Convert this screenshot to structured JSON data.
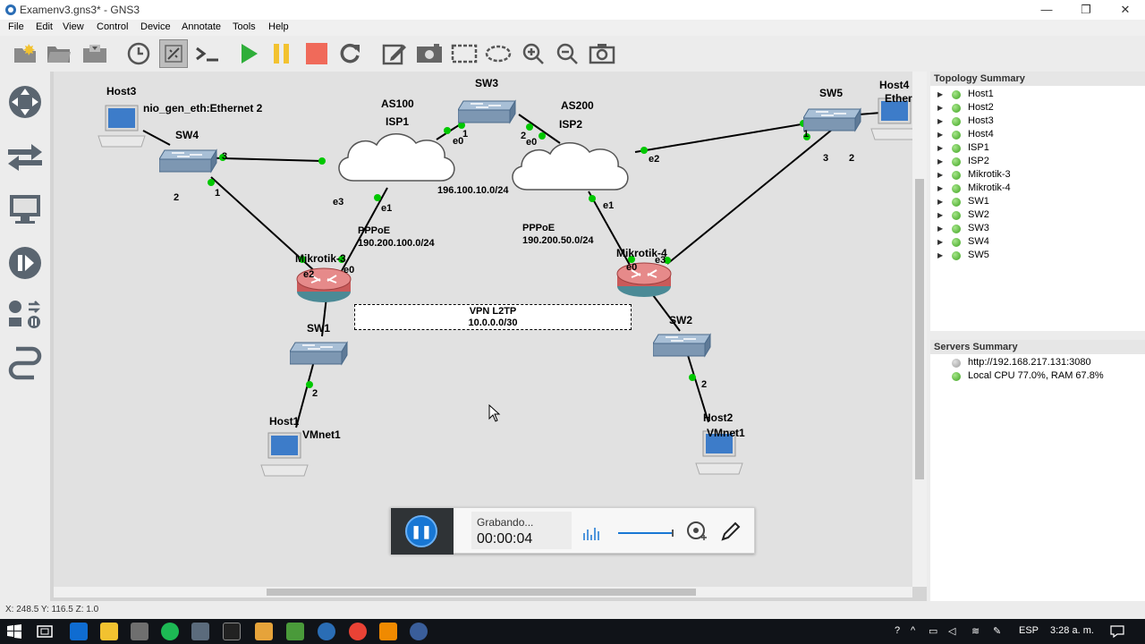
{
  "window": {
    "title": "Examenv3.gns3* - GNS3",
    "minimize": "—",
    "restore": "❐",
    "close": "✕"
  },
  "menu": [
    "File",
    "Edit",
    "View",
    "Control",
    "Device",
    "Annotate",
    "Tools",
    "Help"
  ],
  "toolbar": {
    "icons": [
      "new-project-icon",
      "open-folder-icon",
      "save-icon",
      "snapshot-clock-icon",
      "show-interfaces-icon",
      "console-icon",
      "start-icon",
      "suspend-icon",
      "stop-icon",
      "reload-icon",
      "add-note-icon",
      "insert-picture-icon",
      "draw-rectangle-icon",
      "draw-ellipse-icon",
      "zoom-in-icon",
      "zoom-out-icon",
      "screenshot-icon"
    ]
  },
  "leftbar": {
    "icons": [
      "browse-all-devices-icon",
      "browse-switches-icon",
      "browse-end-devices-icon",
      "browse-security-icon",
      "browse-routers-icon",
      "add-link-icon"
    ]
  },
  "topology": {
    "nodes": {
      "host3": "Host3",
      "host3_iface": "nio_gen_eth:Ethernet 2",
      "sw4": "SW4",
      "as100": "AS100",
      "isp1": "ISP1",
      "sw3": "SW3",
      "as200": "AS200",
      "isp2": "ISP2",
      "sw5": "SW5",
      "host4": "Host4",
      "host4_iface": "Ether",
      "mikrotik3": "Mikrotik-3",
      "mikrotik4": "Mikrotik-4",
      "sw1": "SW1",
      "sw2": "SW2",
      "host1": "Host1",
      "host1_iface": "VMnet1",
      "host2": "Host2",
      "host2_iface": "VMnet1"
    },
    "ports": {
      "sw4_3": "3",
      "sw4_2": "2",
      "sw4_1": "1",
      "isp1_e3": "e3",
      "isp1_e1": "e1",
      "isp1_e0": "e0",
      "sw3_1": "1",
      "sw3_2": "2",
      "isp2_e0": "e0",
      "isp2_e2": "e2",
      "isp2_e1": "e1",
      "sw5_1": "1",
      "sw5_3": "3",
      "sw5_2": "2",
      "mk3_e2": "e2",
      "mk3_e0": "e0",
      "mk4_e0": "e0",
      "mk4_e3": "e3",
      "sw1_2": "2",
      "sw2_2": "2"
    },
    "notes": {
      "isp_link_net": "196.100.10.0/24",
      "pppoe1_title": "PPPoE",
      "pppoe1_net": "190.200.100.0/24",
      "pppoe2_title": "PPPoE",
      "pppoe2_net": "190.200.50.0/24",
      "vpn_title": "VPN L2TP",
      "vpn_net": "10.0.0.0/30"
    }
  },
  "topology_summary": {
    "title": "Topology Summary",
    "items": [
      "Host1",
      "Host2",
      "Host3",
      "Host4",
      "ISP1",
      "ISP2",
      "Mikrotik-3",
      "Mikrotik-4",
      "SW1",
      "SW2",
      "SW3",
      "SW4",
      "SW5"
    ]
  },
  "servers_summary": {
    "title": "Servers Summary",
    "items": [
      "http://192.168.217.131:3080",
      "Local CPU 77.0%, RAM 67.8%"
    ]
  },
  "recorder": {
    "status": "Grabando...",
    "time": "00:00:04"
  },
  "statusbar": {
    "coords": "X: 248.5 Y: 116.5 Z: 1.0"
  },
  "taskbar": {
    "lang": "ESP",
    "time": "3:28 a. m."
  },
  "colors": {
    "link_dot": "#00c800",
    "canvas": "#e1e1e1",
    "taskbar": "#101318",
    "recorder_accent": "#1877d4"
  }
}
